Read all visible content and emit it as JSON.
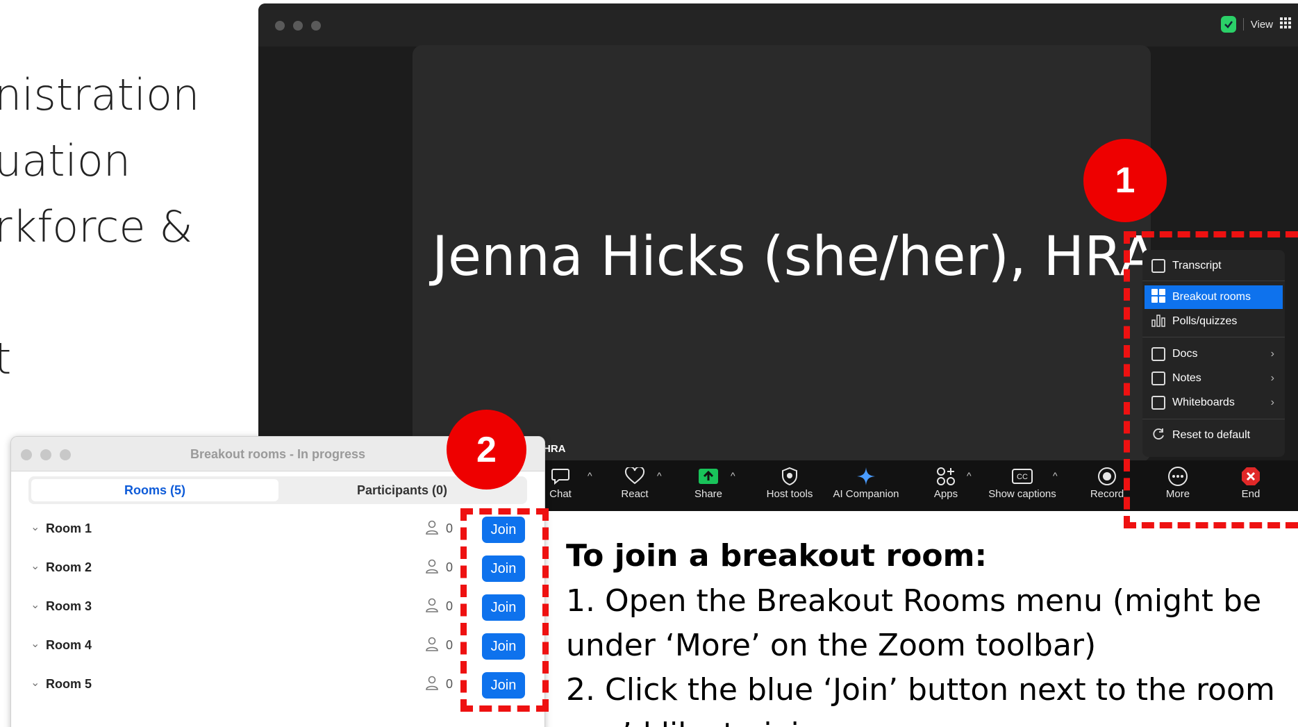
{
  "slide": {
    "bullets": [
      "nistration",
      "uation",
      "rkforce &",
      "t"
    ]
  },
  "zoom": {
    "view_label": "View",
    "speaker_name": "Jenna Hicks (she/her), HRA",
    "tile_label": "HRA",
    "toolbar": [
      {
        "label": "Chat",
        "icon": "chat-icon"
      },
      {
        "label": "React",
        "icon": "heart-icon"
      },
      {
        "label": "Share",
        "icon": "share-icon"
      },
      {
        "label": "Host tools",
        "icon": "shield-icon"
      },
      {
        "label": "AI Companion",
        "icon": "sparkle-icon"
      },
      {
        "label": "Apps",
        "icon": "apps-icon"
      },
      {
        "label": "Show captions",
        "icon": "cc-icon"
      },
      {
        "label": "Record",
        "icon": "record-icon"
      },
      {
        "label": "More",
        "icon": "more-icon"
      },
      {
        "label": "End",
        "icon": "end-icon"
      }
    ],
    "more_menu": [
      {
        "label": "Transcript"
      },
      {
        "label": "Breakout rooms",
        "active": true
      },
      {
        "label": "Polls/quizzes"
      },
      {
        "label": "Docs"
      },
      {
        "label": "Notes"
      },
      {
        "label": "Whiteboards"
      },
      {
        "label": "Reset to default"
      }
    ]
  },
  "badges": {
    "one": "1",
    "two": "2"
  },
  "breakout": {
    "title": "Breakout rooms - In progress",
    "tabs": {
      "rooms": "Rooms (5)",
      "participants": "Participants (0)"
    },
    "rooms": [
      {
        "name": "Room 1",
        "count": "0",
        "join": "Join"
      },
      {
        "name": "Room 2",
        "count": "0",
        "join": "Join"
      },
      {
        "name": "Room 3",
        "count": "0",
        "join": "Join"
      },
      {
        "name": "Room 4",
        "count": "0",
        "join": "Join"
      },
      {
        "name": "Room 5",
        "count": "0",
        "join": "Join"
      }
    ]
  },
  "instructions": {
    "title": "To join a breakout room:",
    "lines": [
      "1.  Open the Breakout Rooms menu (might be",
      "     under ‘More’ on the Zoom toolbar)",
      "2.  Click the blue ‘Join’ button next to the room",
      "     you’d like to join"
    ]
  },
  "colors": {
    "accent": "#0e72ed",
    "highlight": "#ee1111",
    "zoom_bg": "#1c1c1c"
  }
}
